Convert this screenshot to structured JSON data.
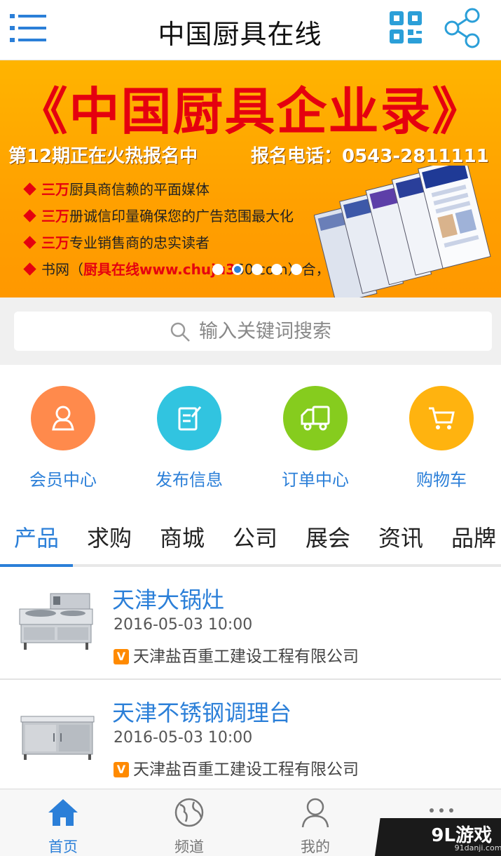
{
  "header": {
    "title": "中国厨具在线",
    "icons": [
      "menu-icon",
      "qr-code-icon",
      "share-icon"
    ]
  },
  "banner": {
    "title": "《中国厨具企业录》",
    "subtitle_left": "第12期正在火热报名中",
    "subtitle_right": "报名电话：0543-2811111",
    "bullets": [
      {
        "red": "三万",
        "text": "厨具商信赖的平面媒体"
      },
      {
        "red": "三万",
        "text": "册诚信印量确保您的广告范围最大化"
      },
      {
        "red": "三万",
        "text": "专业销售商的忠实读者"
      },
      {
        "prefix": "书网（",
        "red": "厨具在线www.chuju3",
        "text": "60.com）合，"
      }
    ],
    "slide_count": 5,
    "active_slide": 1
  },
  "search": {
    "placeholder": "输入关键词搜索"
  },
  "quick_nav": [
    {
      "label": "会员中心",
      "color": "#ff8a4c",
      "icon": "user-icon"
    },
    {
      "label": "发布信息",
      "color": "#31c4e0",
      "icon": "edit-icon"
    },
    {
      "label": "订单中心",
      "color": "#86cc1e",
      "icon": "truck-icon"
    },
    {
      "label": "购物车",
      "color": "#ffb30f",
      "icon": "cart-icon"
    }
  ],
  "tabs": [
    "产品",
    "求购",
    "商城",
    "公司",
    "展会",
    "资讯",
    "品牌"
  ],
  "active_tab": 0,
  "products": [
    {
      "title": "天津大锅灶",
      "date": "2016-05-03 10:00",
      "badge": "V",
      "company": "天津盐百重工建设工程有限公司",
      "thumb": "stove-image"
    },
    {
      "title": "天津不锈钢调理台",
      "date": "2016-05-03 10:00",
      "badge": "V",
      "company": "天津盐百重工建设工程有限公司",
      "thumb": "cabinet-image"
    }
  ],
  "bottom_nav": [
    {
      "label": "首页",
      "icon": "home-icon"
    },
    {
      "label": "频道",
      "icon": "globe-icon"
    },
    {
      "label": "我的",
      "icon": "person-icon"
    },
    {
      "label": "",
      "icon": "more-icon"
    }
  ],
  "watermark": {
    "text": "9L游戏",
    "sub": "91danji.com"
  },
  "colors": {
    "accent": "#2b7fd8",
    "banner_red": "#e5000f",
    "banner_orange": "#ffa000"
  }
}
